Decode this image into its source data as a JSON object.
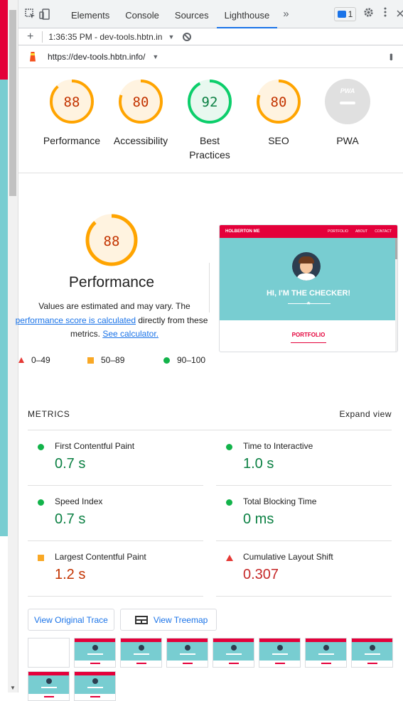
{
  "devtools": {
    "tabs": [
      "Elements",
      "Console",
      "Sources",
      "Lighthouse"
    ],
    "active_tab": "Lighthouse",
    "more_tabs": "»",
    "message_count": "1"
  },
  "report_bar": {
    "report_selector": "1:36:35 PM - dev-tools.hbtn.in",
    "url": "https://dev-tools.hbtn.info/"
  },
  "colors": {
    "pass": "#0cce6b",
    "average": "#ffa400",
    "fail": "#ff4e42",
    "accent": "#1a73e8",
    "site_red": "#e4003a",
    "site_teal": "#78cdd1"
  },
  "gauges": [
    {
      "label": "Performance",
      "score": "88",
      "value": 88,
      "rating": "average"
    },
    {
      "label": "Accessibility",
      "score": "80",
      "value": 80,
      "rating": "average"
    },
    {
      "label": "Best Practices",
      "score": "92",
      "value": 92,
      "rating": "pass"
    },
    {
      "label": "SEO",
      "score": "80",
      "value": 80,
      "rating": "average"
    },
    {
      "label": "PWA",
      "score": "PWA",
      "rating": "na"
    }
  ],
  "performance": {
    "score": "88",
    "value": 88,
    "title": "Performance",
    "note_prefix": "Values are estimated and may vary. The ",
    "note_link": "performance score is calculated",
    "note_middle": " directly from these metrics. ",
    "note_link2": "See calculator.",
    "legend": [
      {
        "shape": "triangle",
        "range": "0–49"
      },
      {
        "shape": "square",
        "range": "50–89"
      },
      {
        "shape": "circle",
        "range": "90–100"
      }
    ]
  },
  "screenshot": {
    "brand": "HOLBERTON ME",
    "nav": [
      "PORTFOLIO",
      "ABOUT",
      "CONTACT"
    ],
    "hero_text": "HI, I'M THE CHECKER!",
    "section_title": "PORTFOLIO"
  },
  "metrics": {
    "title": "METRICS",
    "expand_label": "Expand view",
    "items": [
      {
        "name": "First Contentful Paint",
        "value": "0.7 s",
        "rating": "pass"
      },
      {
        "name": "Time to Interactive",
        "value": "1.0 s",
        "rating": "pass"
      },
      {
        "name": "Speed Index",
        "value": "0.7 s",
        "rating": "pass"
      },
      {
        "name": "Total Blocking Time",
        "value": "0 ms",
        "rating": "pass"
      },
      {
        "name": "Largest Contentful Paint",
        "value": "1.2 s",
        "rating": "average"
      },
      {
        "name": "Cumulative Layout Shift",
        "value": "0.307",
        "rating": "fail"
      }
    ]
  },
  "buttons": {
    "view_trace": "View Original Trace",
    "view_treemap": "View Treemap"
  },
  "filmstrip_frames": 10
}
